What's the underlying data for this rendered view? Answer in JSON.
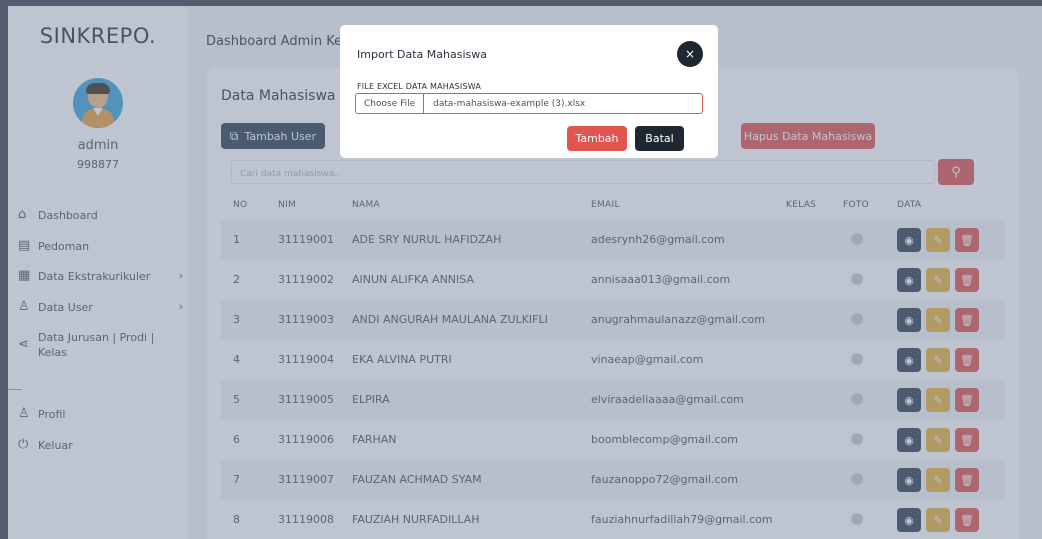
{
  "brand": "SINKREPO.",
  "user": {
    "name": "admin",
    "id": "998877"
  },
  "sidebar": {
    "items": [
      {
        "label": "Dashboard",
        "icon": "home-icon"
      },
      {
        "label": "Pedoman",
        "icon": "book-icon"
      },
      {
        "label": "Data Ekstrakurikuler",
        "icon": "list-icon",
        "chevron": "›"
      },
      {
        "label": "Data User",
        "icon": "user-icon",
        "chevron": "›"
      },
      {
        "label": "Data Jurusan | Prodi | Kelas",
        "icon": "share-icon"
      },
      {
        "label": "Profil",
        "icon": "user-icon"
      },
      {
        "label": "Keluar",
        "icon": "power-icon"
      }
    ]
  },
  "header": {
    "title": "Dashboard Admin Kema"
  },
  "card": {
    "title": "Data Mahasiswa",
    "add_user_label": "Tambah User",
    "delete_all_label": "Hapus Data Mahasiswa",
    "search_placeholder": "Cari data mahasiswa.."
  },
  "table": {
    "headers": [
      "NO",
      "NIM",
      "NAMA",
      "EMAIL",
      "KELAS",
      "FOTO",
      "DATA"
    ],
    "rows": [
      {
        "no": "1",
        "nim": "31119001",
        "nama": "ADE SRY NURUL HAFIDZAH",
        "email": "adesrynh26@gmail.com"
      },
      {
        "no": "2",
        "nim": "31119002",
        "nama": "AINUN ALIFKA ANNISA",
        "email": "annisaaa013@gmail.com"
      },
      {
        "no": "3",
        "nim": "31119003",
        "nama": "ANDI ANGURAH MAULANA ZULKIFLI",
        "email": "anugrahmaulanazz@gmail.com"
      },
      {
        "no": "4",
        "nim": "31119004",
        "nama": "EKA ALVINA PUTRI",
        "email": "vinaeap@gmail.com"
      },
      {
        "no": "5",
        "nim": "31119005",
        "nama": "ELPIRA",
        "email": "elviraadeliaaaa@gmail.com"
      },
      {
        "no": "6",
        "nim": "31119006",
        "nama": "FARHAN",
        "email": "boomblecomp@gmail.com"
      },
      {
        "no": "7",
        "nim": "31119007",
        "nama": "FAUZAN ACHMAD SYAM",
        "email": "fauzanoppo72@gmail.com"
      },
      {
        "no": "8",
        "nim": "31119008",
        "nama": "FAUZIAH NURFADILLAH",
        "email": "fauziahnurfadillah79@gmail.com"
      }
    ]
  },
  "modal": {
    "title": "Import Data Mahasiswa",
    "close_label": "×",
    "field_label": "FILE EXCEL DATA MAHASISWA",
    "choose_file_label": "Choose File",
    "file_name": "data-mahasiswa-example (3).xlsx",
    "submit_label": "Tambah",
    "cancel_label": "Batal"
  },
  "colors": {
    "primary_dark": "#2c3e50",
    "danger": "#e0554f",
    "warning": "#e8b23a"
  }
}
